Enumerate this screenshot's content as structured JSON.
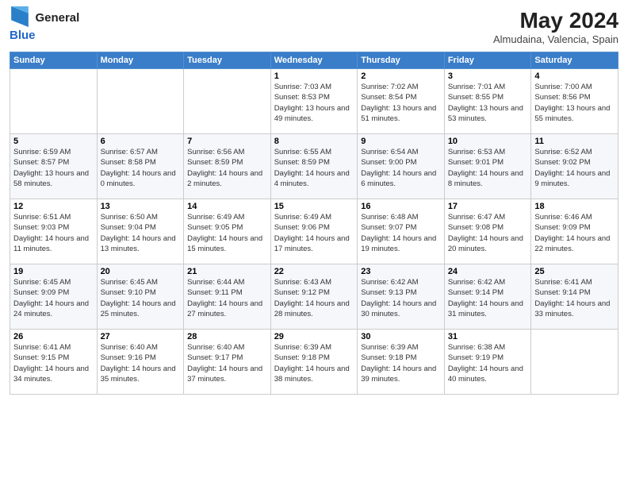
{
  "logo": {
    "line1": "General",
    "line2": "Blue"
  },
  "title": "May 2024",
  "location": "Almudaina, Valencia, Spain",
  "days_header": [
    "Sunday",
    "Monday",
    "Tuesday",
    "Wednesday",
    "Thursday",
    "Friday",
    "Saturday"
  ],
  "weeks": [
    [
      {
        "day": "",
        "sunrise": "",
        "sunset": "",
        "daylight": ""
      },
      {
        "day": "",
        "sunrise": "",
        "sunset": "",
        "daylight": ""
      },
      {
        "day": "",
        "sunrise": "",
        "sunset": "",
        "daylight": ""
      },
      {
        "day": "1",
        "sunrise": "Sunrise: 7:03 AM",
        "sunset": "Sunset: 8:53 PM",
        "daylight": "Daylight: 13 hours and 49 minutes."
      },
      {
        "day": "2",
        "sunrise": "Sunrise: 7:02 AM",
        "sunset": "Sunset: 8:54 PM",
        "daylight": "Daylight: 13 hours and 51 minutes."
      },
      {
        "day": "3",
        "sunrise": "Sunrise: 7:01 AM",
        "sunset": "Sunset: 8:55 PM",
        "daylight": "Daylight: 13 hours and 53 minutes."
      },
      {
        "day": "4",
        "sunrise": "Sunrise: 7:00 AM",
        "sunset": "Sunset: 8:56 PM",
        "daylight": "Daylight: 13 hours and 55 minutes."
      }
    ],
    [
      {
        "day": "5",
        "sunrise": "Sunrise: 6:59 AM",
        "sunset": "Sunset: 8:57 PM",
        "daylight": "Daylight: 13 hours and 58 minutes."
      },
      {
        "day": "6",
        "sunrise": "Sunrise: 6:57 AM",
        "sunset": "Sunset: 8:58 PM",
        "daylight": "Daylight: 14 hours and 0 minutes."
      },
      {
        "day": "7",
        "sunrise": "Sunrise: 6:56 AM",
        "sunset": "Sunset: 8:59 PM",
        "daylight": "Daylight: 14 hours and 2 minutes."
      },
      {
        "day": "8",
        "sunrise": "Sunrise: 6:55 AM",
        "sunset": "Sunset: 8:59 PM",
        "daylight": "Daylight: 14 hours and 4 minutes."
      },
      {
        "day": "9",
        "sunrise": "Sunrise: 6:54 AM",
        "sunset": "Sunset: 9:00 PM",
        "daylight": "Daylight: 14 hours and 6 minutes."
      },
      {
        "day": "10",
        "sunrise": "Sunrise: 6:53 AM",
        "sunset": "Sunset: 9:01 PM",
        "daylight": "Daylight: 14 hours and 8 minutes."
      },
      {
        "day": "11",
        "sunrise": "Sunrise: 6:52 AM",
        "sunset": "Sunset: 9:02 PM",
        "daylight": "Daylight: 14 hours and 9 minutes."
      }
    ],
    [
      {
        "day": "12",
        "sunrise": "Sunrise: 6:51 AM",
        "sunset": "Sunset: 9:03 PM",
        "daylight": "Daylight: 14 hours and 11 minutes."
      },
      {
        "day": "13",
        "sunrise": "Sunrise: 6:50 AM",
        "sunset": "Sunset: 9:04 PM",
        "daylight": "Daylight: 14 hours and 13 minutes."
      },
      {
        "day": "14",
        "sunrise": "Sunrise: 6:49 AM",
        "sunset": "Sunset: 9:05 PM",
        "daylight": "Daylight: 14 hours and 15 minutes."
      },
      {
        "day": "15",
        "sunrise": "Sunrise: 6:49 AM",
        "sunset": "Sunset: 9:06 PM",
        "daylight": "Daylight: 14 hours and 17 minutes."
      },
      {
        "day": "16",
        "sunrise": "Sunrise: 6:48 AM",
        "sunset": "Sunset: 9:07 PM",
        "daylight": "Daylight: 14 hours and 19 minutes."
      },
      {
        "day": "17",
        "sunrise": "Sunrise: 6:47 AM",
        "sunset": "Sunset: 9:08 PM",
        "daylight": "Daylight: 14 hours and 20 minutes."
      },
      {
        "day": "18",
        "sunrise": "Sunrise: 6:46 AM",
        "sunset": "Sunset: 9:09 PM",
        "daylight": "Daylight: 14 hours and 22 minutes."
      }
    ],
    [
      {
        "day": "19",
        "sunrise": "Sunrise: 6:45 AM",
        "sunset": "Sunset: 9:09 PM",
        "daylight": "Daylight: 14 hours and 24 minutes."
      },
      {
        "day": "20",
        "sunrise": "Sunrise: 6:45 AM",
        "sunset": "Sunset: 9:10 PM",
        "daylight": "Daylight: 14 hours and 25 minutes."
      },
      {
        "day": "21",
        "sunrise": "Sunrise: 6:44 AM",
        "sunset": "Sunset: 9:11 PM",
        "daylight": "Daylight: 14 hours and 27 minutes."
      },
      {
        "day": "22",
        "sunrise": "Sunrise: 6:43 AM",
        "sunset": "Sunset: 9:12 PM",
        "daylight": "Daylight: 14 hours and 28 minutes."
      },
      {
        "day": "23",
        "sunrise": "Sunrise: 6:42 AM",
        "sunset": "Sunset: 9:13 PM",
        "daylight": "Daylight: 14 hours and 30 minutes."
      },
      {
        "day": "24",
        "sunrise": "Sunrise: 6:42 AM",
        "sunset": "Sunset: 9:14 PM",
        "daylight": "Daylight: 14 hours and 31 minutes."
      },
      {
        "day": "25",
        "sunrise": "Sunrise: 6:41 AM",
        "sunset": "Sunset: 9:14 PM",
        "daylight": "Daylight: 14 hours and 33 minutes."
      }
    ],
    [
      {
        "day": "26",
        "sunrise": "Sunrise: 6:41 AM",
        "sunset": "Sunset: 9:15 PM",
        "daylight": "Daylight: 14 hours and 34 minutes."
      },
      {
        "day": "27",
        "sunrise": "Sunrise: 6:40 AM",
        "sunset": "Sunset: 9:16 PM",
        "daylight": "Daylight: 14 hours and 35 minutes."
      },
      {
        "day": "28",
        "sunrise": "Sunrise: 6:40 AM",
        "sunset": "Sunset: 9:17 PM",
        "daylight": "Daylight: 14 hours and 37 minutes."
      },
      {
        "day": "29",
        "sunrise": "Sunrise: 6:39 AM",
        "sunset": "Sunset: 9:18 PM",
        "daylight": "Daylight: 14 hours and 38 minutes."
      },
      {
        "day": "30",
        "sunrise": "Sunrise: 6:39 AM",
        "sunset": "Sunset: 9:18 PM",
        "daylight": "Daylight: 14 hours and 39 minutes."
      },
      {
        "day": "31",
        "sunrise": "Sunrise: 6:38 AM",
        "sunset": "Sunset: 9:19 PM",
        "daylight": "Daylight: 14 hours and 40 minutes."
      },
      {
        "day": "",
        "sunrise": "",
        "sunset": "",
        "daylight": ""
      }
    ]
  ]
}
